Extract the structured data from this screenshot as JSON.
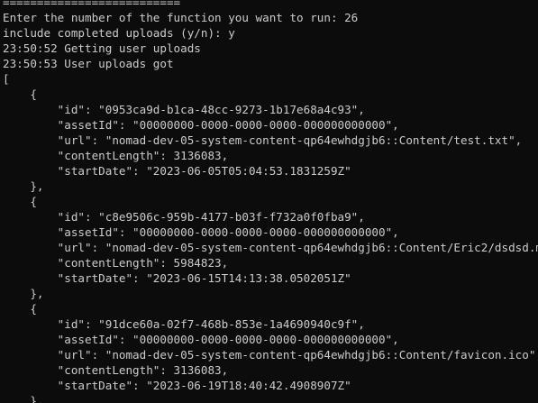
{
  "terminal": {
    "lines": [
      "==========================",
      "Enter the number of the function you want to run: 26",
      "include completed uploads (y/n): y",
      "23:50:52 Getting user uploads",
      "23:50:53 User uploads got",
      "[",
      "    {",
      "        \"id\": \"0953ca9d-b1ca-48cc-9273-1b17e68a4c93\",",
      "        \"assetId\": \"00000000-0000-0000-0000-000000000000\",",
      "        \"url\": \"nomad-dev-05-system-content-qp64ewhdgjb6::Content/test.txt\",",
      "        \"contentLength\": 3136083,",
      "        \"startDate\": \"2023-06-05T05:04:53.1831259Z\"",
      "    },",
      "    {",
      "        \"id\": \"c8e9506c-959b-4177-b03f-f732a0f0fba9\",",
      "        \"assetId\": \"00000000-0000-0000-0000-000000000000\",",
      "        \"url\": \"nomad-dev-05-system-content-qp64ewhdgjb6::Content/Eric2/dsdsd.mp4\",",
      "        \"contentLength\": 5984823,",
      "        \"startDate\": \"2023-06-15T14:13:38.0502051Z\"",
      "    },",
      "    {",
      "        \"id\": \"91dce60a-02f7-468b-853e-1a4690940c9f\",",
      "        \"assetId\": \"00000000-0000-0000-0000-000000000000\",",
      "        \"url\": \"nomad-dev-05-system-content-qp64ewhdgjb6::Content/favicon.ico\",",
      "        \"contentLength\": 3136083,",
      "        \"startDate\": \"2023-06-19T18:40:42.4908907Z\"",
      "    },"
    ],
    "colors": {
      "background": "#0c0c0c",
      "foreground": "#cccccc"
    }
  }
}
